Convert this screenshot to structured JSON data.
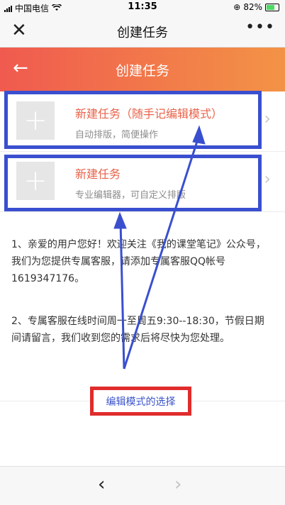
{
  "status": {
    "carrier": "中国电信",
    "time": "11:35",
    "battery": "82%",
    "battery_level": 0.82
  },
  "nav": {
    "title": "创建任务",
    "close_icon": "close-icon",
    "more_icon": "more-icon"
  },
  "header": {
    "title": "创建任务",
    "back_icon": "back-arrow-icon"
  },
  "options": [
    {
      "title": "新建任务（随手记编辑模式）",
      "desc": "自动排版，简便操作"
    },
    {
      "title": "新建任务",
      "desc": "专业编辑器，可自定义排版"
    }
  ],
  "notice": {
    "p1": "1、亲爱的用户您好！欢迎关注《我的课堂笔记》公众号，我们为您提供专属客服，请添加专属客服QQ帐号 1619347176。",
    "p2": "2、专属客服在线时间周一至周五9:30--18:30，节假日期间请留言，我们收到您的需求后将尽快为您处理。"
  },
  "annotation": {
    "caption": "编辑模式的选择"
  },
  "colors": {
    "header_start": "#f05a4f",
    "header_end": "#f39346",
    "highlight_blue": "#3a4fcf",
    "caption_red": "#e02c2c",
    "option_title": "#e9624a"
  }
}
